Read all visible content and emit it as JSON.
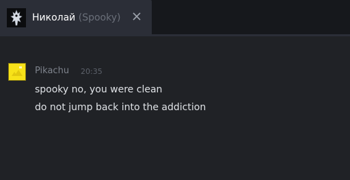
{
  "tab": {
    "name": "Николай",
    "nickname": "(Spooky)",
    "close_icon": "close-icon"
  },
  "message": {
    "author": "Pikachu",
    "time": "20:35",
    "lines": [
      "spooky no, you were clean",
      "do not jump back into the addiction"
    ]
  }
}
